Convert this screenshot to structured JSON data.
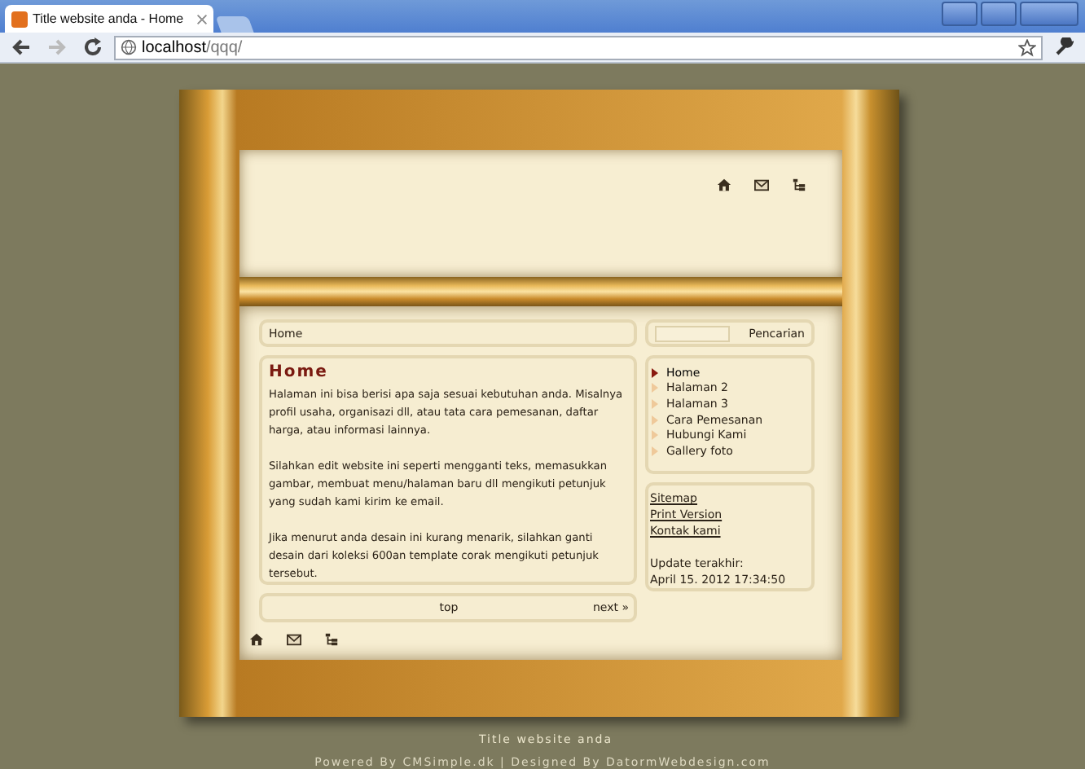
{
  "browser": {
    "tab_title": "Title website anda - Home",
    "url_host": "localhost",
    "url_path": "/qqq/"
  },
  "breadcrumb": "Home",
  "search": {
    "button": "Pencarian"
  },
  "article": {
    "title": "Home",
    "paragraphs": [
      "Halaman ini bisa berisi apa saja sesuai kebutuhan anda. Misalnya profil usaha, organisazi dll, atau tata cara pemesanan, daftar harga, atau informasi lainnya.",
      "Silahkan edit website ini seperti mengganti teks, memasukkan gambar, membuat menu/halaman baru dll mengikuti petunjuk yang sudah kami kirim ke email.",
      "Jika menurut anda desain ini kurang menarik, silahkan ganti desain dari koleksi 600an template corak mengikuti petunjuk tersebut."
    ]
  },
  "menu": [
    {
      "label": "Home",
      "selected": true
    },
    {
      "label": "Halaman 2",
      "selected": false
    },
    {
      "label": "Halaman 3",
      "selected": false
    },
    {
      "label": "Cara Pemesanan",
      "selected": false
    },
    {
      "label": "Hubungi Kami",
      "selected": false
    },
    {
      "label": "Gallery foto",
      "selected": false
    }
  ],
  "links": [
    "Sitemap",
    "Print Version",
    "Kontak kami"
  ],
  "update": {
    "label": "Update terakhir:",
    "date": "April 15. 2012 17:34:50"
  },
  "pager": {
    "top": "top",
    "next": "next »"
  },
  "footer": {
    "title": "Title website anda",
    "credits": "Powered By CMSimple.dk | Designed By DatormWebdesign.com"
  }
}
